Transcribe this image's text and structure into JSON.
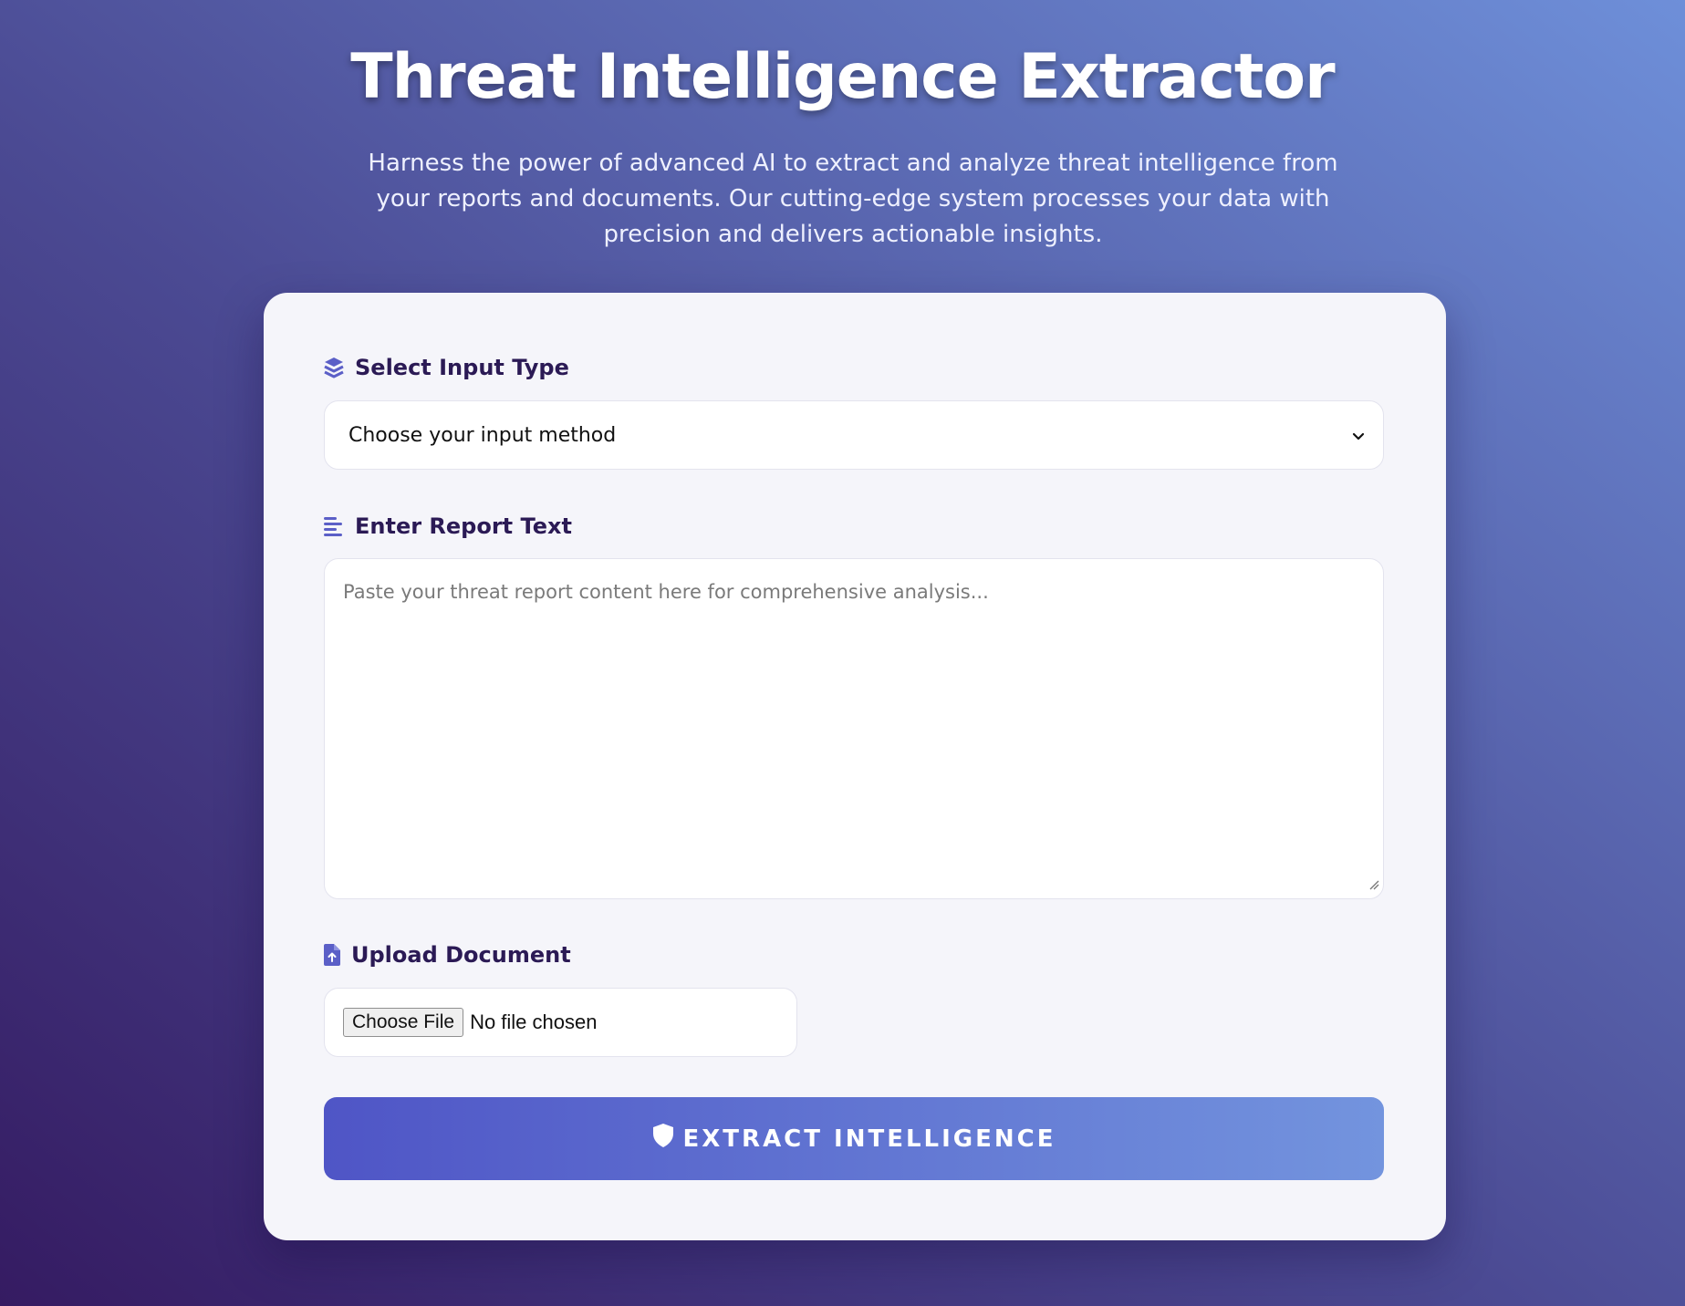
{
  "header": {
    "title": "Threat Intelligence Extractor",
    "subtitle": "Harness the power of advanced AI to extract and analyze threat intelligence from your reports and documents. Our cutting-edge system processes your data with precision and delivers actionable insights."
  },
  "form": {
    "input_type": {
      "label": "Select Input Type",
      "selected": "Choose your input method",
      "icon": "layers-icon"
    },
    "report_text": {
      "label": "Enter Report Text",
      "placeholder": "Paste your threat report content here for comprehensive analysis...",
      "icon": "align-left-icon"
    },
    "upload": {
      "label": "Upload Document",
      "button_label": "Choose File",
      "status": "No file chosen",
      "icon": "file-upload-icon"
    },
    "submit": {
      "label": "EXTRACT INTELLIGENCE",
      "icon": "shield-icon"
    }
  },
  "colors": {
    "accent": "#5b5fc7",
    "label_text": "#2b1a55",
    "button_start": "#4f55c6",
    "button_end": "#7394de"
  }
}
